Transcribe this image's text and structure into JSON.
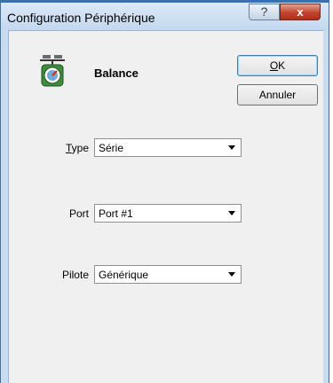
{
  "window": {
    "title": "Configuration Périphérique",
    "help_button": "?",
    "close_button": "x"
  },
  "device": {
    "icon": "scale-icon",
    "name": "Balance"
  },
  "buttons": {
    "ok_mnemonic": "O",
    "ok_rest": "K",
    "cancel": "Annuler"
  },
  "fields": {
    "type": {
      "label_mnemonic": "T",
      "label_rest": "ype",
      "value": "Série"
    },
    "port": {
      "label": "Port",
      "value": "Port #1"
    },
    "pilote": {
      "label": "Pilote",
      "value": "Générique"
    }
  }
}
